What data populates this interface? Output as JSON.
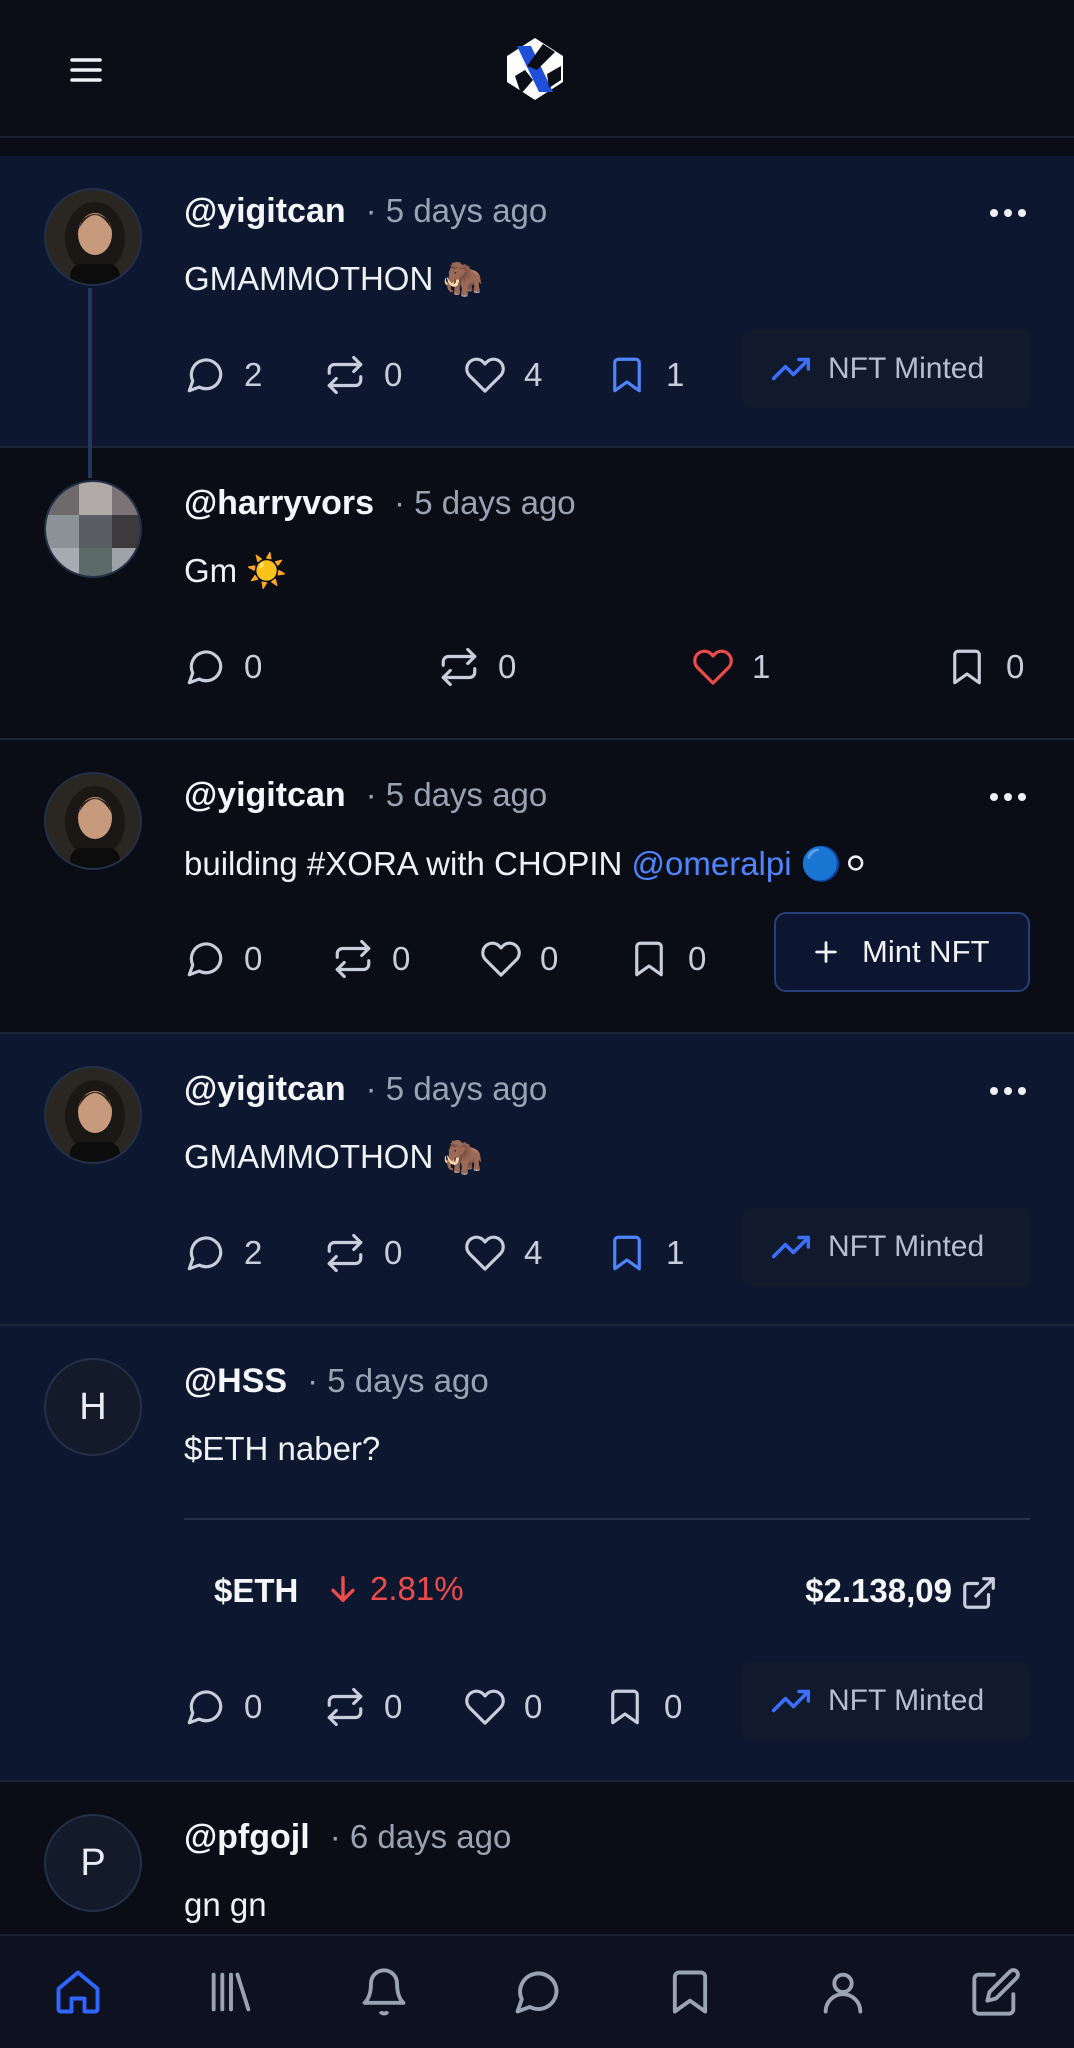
{
  "app": {
    "menu_icon": "hamburger-menu-icon",
    "logo": "xora-logo"
  },
  "colors": {
    "background": "#0a0d16",
    "highlight_post": "#0d1830",
    "accent_blue": "#4f86ff",
    "like_red": "#ef4b4b",
    "muted_text": "#9aa3b4"
  },
  "posts": [
    {
      "handle": "@yigitcan",
      "time": "· 5 days ago",
      "text": "GMAMMOTHON 🦣",
      "comments": "2",
      "reposts": "0",
      "likes": "4",
      "bookmarks": "1",
      "badge": "NFT Minted"
    },
    {
      "handle": "@harryvors",
      "time": "· 5 days ago",
      "text": "Gm ☀️",
      "comments": "0",
      "reposts": "0",
      "likes": "1",
      "bookmarks": "0"
    },
    {
      "handle": "@yigitcan",
      "time": "· 5 days ago",
      "text_before": "building #XORA with CHOPIN ",
      "mention": "@omeralpi",
      "text_after": " 🔵⚪",
      "comments": "0",
      "reposts": "0",
      "likes": "0",
      "bookmarks": "0",
      "button": "Mint NFT"
    },
    {
      "handle": "@yigitcan",
      "time": "· 5 days ago",
      "text": "GMAMMOTHON 🦣",
      "comments": "2",
      "reposts": "0",
      "likes": "4",
      "bookmarks": "1",
      "badge": "NFT Minted"
    },
    {
      "avatar_letter": "H",
      "handle": "@HSS",
      "time": "· 5 days ago",
      "text": "$ETH naber?",
      "ticker": {
        "symbol": "$ETH",
        "change": "2.81%",
        "direction": "down",
        "price": "$2.138,09"
      },
      "comments": "0",
      "reposts": "0",
      "likes": "0",
      "bookmarks": "0",
      "badge": "NFT Minted"
    },
    {
      "avatar_letter": "P",
      "handle": "@pfgojl",
      "time": "· 6 days ago",
      "text": "gn gn"
    }
  ],
  "bottom_nav": [
    "home-icon",
    "library-icon",
    "bell-icon",
    "chat-icon",
    "bookmark-icon",
    "profile-icon",
    "compose-icon"
  ]
}
